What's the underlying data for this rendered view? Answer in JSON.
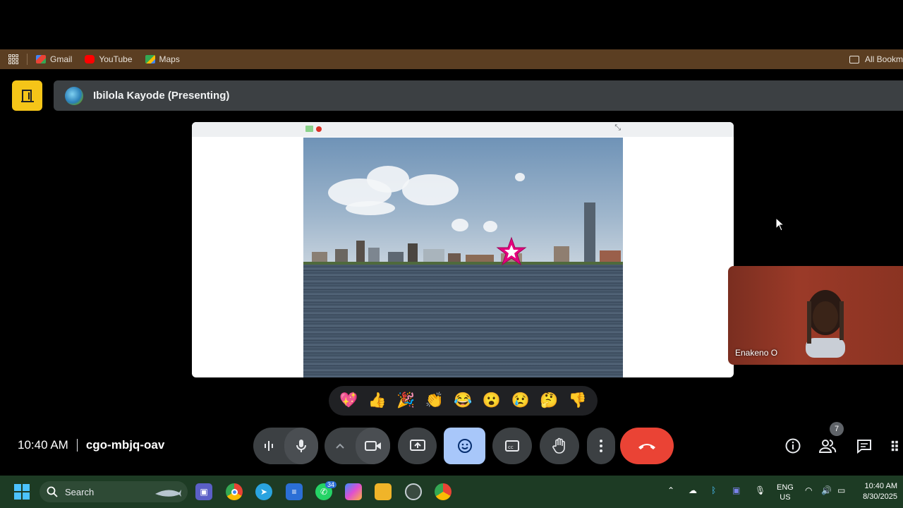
{
  "bookmarks": {
    "items": [
      {
        "label": "Gmail",
        "color": "#ea4335"
      },
      {
        "label": "YouTube",
        "color": "#ff0000"
      },
      {
        "label": "Maps",
        "color": "#34a853"
      }
    ],
    "all_label": "All Bookm"
  },
  "meeting": {
    "presenter": "Ibilola Kayode (Presenting)",
    "time": "10:40 AM",
    "code": "cgo-mbjq-oav",
    "participant_tile_name": "Enakeno O",
    "participants_count": "7"
  },
  "reactions": [
    "💖",
    "👍",
    "🎉",
    "👏",
    "😂",
    "😮",
    "😢",
    "🤔",
    "👎"
  ],
  "controls": [
    {
      "name": "audio-levels-button",
      "icon": "audio-levels-icon"
    },
    {
      "name": "microphone-button",
      "icon": "microphone-icon"
    },
    {
      "name": "camera-options-button",
      "icon": "chevron-up-icon"
    },
    {
      "name": "camera-button",
      "icon": "camera-icon"
    },
    {
      "name": "present-button",
      "icon": "present-screen-icon"
    },
    {
      "name": "reactions-button",
      "icon": "emoji-icon"
    },
    {
      "name": "captions-button",
      "icon": "captions-icon"
    },
    {
      "name": "raise-hand-button",
      "icon": "hand-icon"
    },
    {
      "name": "more-options-button",
      "icon": "more-vertical-icon"
    },
    {
      "name": "leave-call-button",
      "icon": "phone-hangup-icon"
    }
  ],
  "taskbar": {
    "search_label": "Search",
    "whatsapp_badge": "34",
    "lang_line1": "ENG",
    "lang_line2": "US",
    "clock_time": "10:40 AM",
    "clock_date": "8/30/2025"
  },
  "colors": {
    "bookmarks_bar": "#5b3e22",
    "exit_button": "#f5c518",
    "reactions_active": "#a8c7fa",
    "leave_call": "#ea4335",
    "taskbar": "#1d3b24"
  }
}
